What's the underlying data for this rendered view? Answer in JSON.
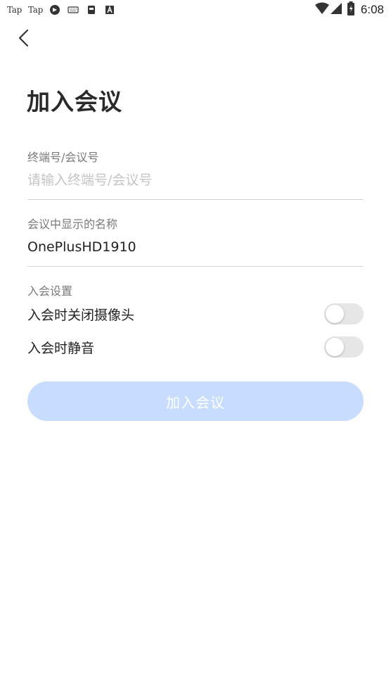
{
  "status_bar": {
    "left_items": [
      "Tap",
      "Tap"
    ],
    "icons": [
      "app-icon",
      "keyboard-icon",
      "sim-card-icon",
      "text-icon"
    ],
    "right_icons": [
      "wifi-icon",
      "signal-icon",
      "battery-charging-icon"
    ],
    "time": "6:08"
  },
  "header": {
    "back_icon": "chevron-left-icon",
    "title": "加入会议"
  },
  "form": {
    "meeting_id": {
      "label": "终端号/会议号",
      "value": "",
      "placeholder": "请输入终端号/会议号"
    },
    "display_name": {
      "label": "会议中显示的名称",
      "value": "OnePlusHD1910"
    }
  },
  "settings": {
    "label": "入会设置",
    "options": [
      {
        "label": "入会时关闭摄像头",
        "enabled": false
      },
      {
        "label": "入会时静音",
        "enabled": false
      }
    ]
  },
  "join_button": {
    "label": "加入会议",
    "disabled": true
  },
  "colors": {
    "accent_disabled": "#c8dcff",
    "toggle_off": "#e6e6e6",
    "placeholder": "#c4c4c4"
  }
}
